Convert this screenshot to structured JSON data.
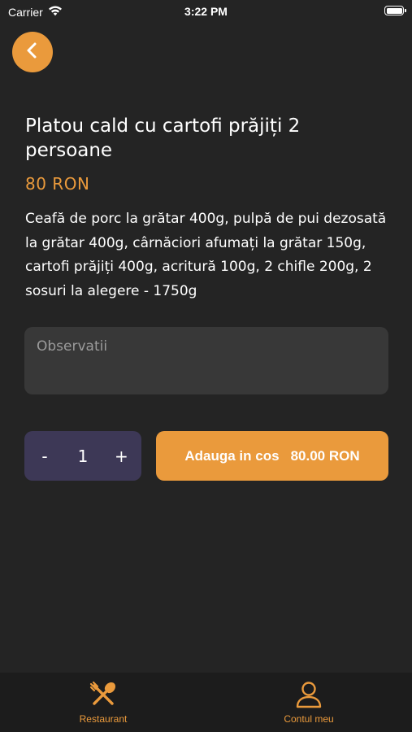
{
  "status_bar": {
    "carrier": "Carrier",
    "time": "3:22 PM"
  },
  "colors": {
    "accent": "#EA9A3C",
    "background": "#242424",
    "field": "#383838",
    "stepper": "#3D3856",
    "tab_bar": "#1C1C1C"
  },
  "product": {
    "title": "Platou cald cu cartofi prăjiți 2 persoane",
    "price": "80 RON",
    "description": "Ceafă de porc la grătar 400g, pulpă de pui dezosată la grătar 400g, cârnăciori afumați la grătar 150g, cartofi prăjiți 400g, acritură 100g, 2 chifle 200g, 2 sosuri la alegere - 1750g"
  },
  "notes": {
    "placeholder": "Observatii",
    "value": ""
  },
  "stepper": {
    "minus_label": "-",
    "quantity": "1",
    "plus_label": "+"
  },
  "add_to_cart": {
    "label": "Adauga in cos",
    "total": "80.00 RON"
  },
  "tabs": [
    {
      "label": "Restaurant",
      "icon": "fork-knife-icon"
    },
    {
      "label": "Contul meu",
      "icon": "user-icon"
    }
  ]
}
